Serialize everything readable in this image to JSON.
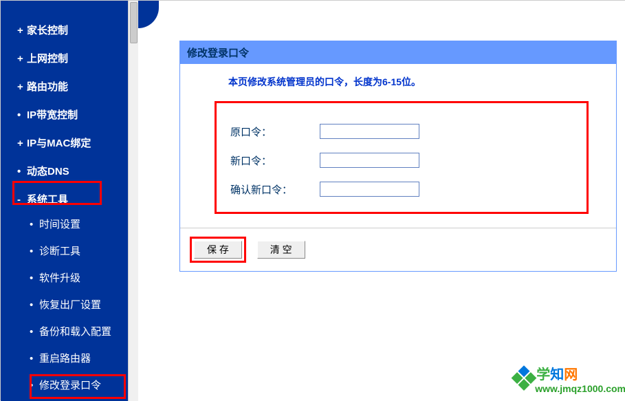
{
  "sidebar": {
    "top_items": [
      {
        "prefix": "+",
        "label": "家长控制"
      },
      {
        "prefix": "+",
        "label": "上网控制"
      },
      {
        "prefix": "+",
        "label": "路由功能"
      },
      {
        "prefix": "•",
        "label": "IP带宽控制"
      },
      {
        "prefix": "+",
        "label": "IP与MAC绑定"
      },
      {
        "prefix": "•",
        "label": "动态DNS"
      },
      {
        "prefix": "-",
        "label": "系统工具"
      }
    ],
    "sub_items": [
      {
        "label": "时间设置"
      },
      {
        "label": "诊断工具"
      },
      {
        "label": "软件升级"
      },
      {
        "label": "恢复出厂设置"
      },
      {
        "label": "备份和载入配置"
      },
      {
        "label": "重启路由器"
      },
      {
        "label": "修改登录口令"
      }
    ]
  },
  "panel": {
    "title": "修改登录口令",
    "desc": "本页修改系统管理员的口令，长度为6-15位。",
    "fields": {
      "old_label": "原口令：",
      "new_label": "新口令：",
      "confirm_label": "确认新口令：",
      "old_value": "",
      "new_value": "",
      "confirm_value": ""
    },
    "buttons": {
      "save": "保 存",
      "clear": "清 空"
    }
  },
  "watermark": {
    "brand": "学知网",
    "url": "www.jmqz1000.com"
  }
}
